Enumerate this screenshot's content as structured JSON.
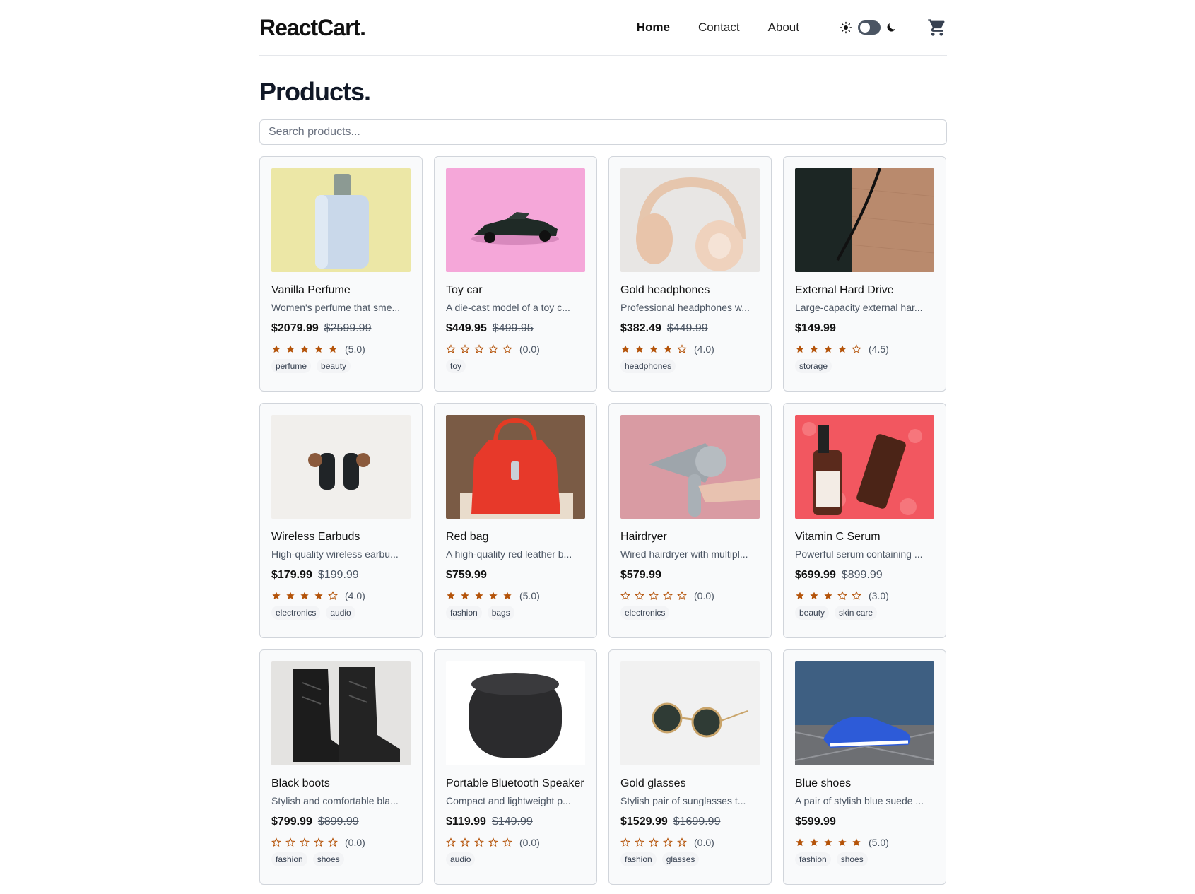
{
  "brand": {
    "name": "ReactCart."
  },
  "nav": {
    "items": [
      {
        "label": "Home",
        "active": true
      },
      {
        "label": "Contact",
        "active": false
      },
      {
        "label": "About",
        "active": false
      }
    ]
  },
  "theme_toggle": {
    "state": "light"
  },
  "page_title": "Products.",
  "search": {
    "placeholder": "Search products...",
    "value": ""
  },
  "colors": {
    "star": "#b45309",
    "card_bg": "#f9fafb",
    "border": "#d1d5db"
  },
  "products": [
    {
      "title": "Vanilla Perfume",
      "desc": "Women's perfume that sme...",
      "price": "$2079.99",
      "old_price": "$2599.99",
      "rating": 5.0,
      "rating_text": "(5.0)",
      "tags": [
        "perfume",
        "beauty"
      ],
      "image": "perfume"
    },
    {
      "title": "Toy car",
      "desc": "A die-cast model of a toy c...",
      "price": "$449.95",
      "old_price": "$499.95",
      "rating": 0.0,
      "rating_text": "(0.0)",
      "tags": [
        "toy"
      ],
      "image": "toycar"
    },
    {
      "title": "Gold headphones",
      "desc": "Professional headphones w...",
      "price": "$382.49",
      "old_price": "$449.99",
      "rating": 4.0,
      "rating_text": "(4.0)",
      "tags": [
        "headphones"
      ],
      "image": "headphones"
    },
    {
      "title": "External Hard Drive",
      "desc": "Large-capacity external har...",
      "price": "$149.99",
      "old_price": "",
      "rating": 4.5,
      "rating_text": "(4.5)",
      "tags": [
        "storage"
      ],
      "image": "harddrive"
    },
    {
      "title": "Wireless Earbuds",
      "desc": "High-quality wireless earbu...",
      "price": "$179.99",
      "old_price": "$199.99",
      "rating": 4.0,
      "rating_text": "(4.0)",
      "tags": [
        "electronics",
        "audio"
      ],
      "image": "earbuds"
    },
    {
      "title": "Red bag",
      "desc": "A high-quality red leather b...",
      "price": "$759.99",
      "old_price": "",
      "rating": 5.0,
      "rating_text": "(5.0)",
      "tags": [
        "fashion",
        "bags"
      ],
      "image": "redbag"
    },
    {
      "title": "Hairdryer",
      "desc": "Wired hairdryer with multipl...",
      "price": "$579.99",
      "old_price": "",
      "rating": 0.0,
      "rating_text": "(0.0)",
      "tags": [
        "electronics"
      ],
      "image": "hairdryer"
    },
    {
      "title": "Vitamin C Serum",
      "desc": "Powerful serum containing ...",
      "price": "$699.99",
      "old_price": "$899.99",
      "rating": 3.0,
      "rating_text": "(3.0)",
      "tags": [
        "beauty",
        "skin care"
      ],
      "image": "serum"
    },
    {
      "title": "Black boots",
      "desc": "Stylish and comfortable bla...",
      "price": "$799.99",
      "old_price": "$899.99",
      "rating": 0.0,
      "rating_text": "(0.0)",
      "tags": [
        "fashion",
        "shoes"
      ],
      "image": "boots"
    },
    {
      "title": "Portable Bluetooth Speaker",
      "desc": "Compact and lightweight p...",
      "price": "$119.99",
      "old_price": "$149.99",
      "rating": 0.0,
      "rating_text": "(0.0)",
      "tags": [
        "audio"
      ],
      "image": "speaker"
    },
    {
      "title": "Gold glasses",
      "desc": "Stylish pair of sunglasses t...",
      "price": "$1529.99",
      "old_price": "$1699.99",
      "rating": 0.0,
      "rating_text": "(0.0)",
      "tags": [
        "fashion",
        "glasses"
      ],
      "image": "glasses"
    },
    {
      "title": "Blue shoes",
      "desc": "A pair of stylish blue suede ...",
      "price": "$599.99",
      "old_price": "",
      "rating": 5.0,
      "rating_text": "(5.0)",
      "tags": [
        "fashion",
        "shoes"
      ],
      "image": "blueshoes"
    }
  ]
}
